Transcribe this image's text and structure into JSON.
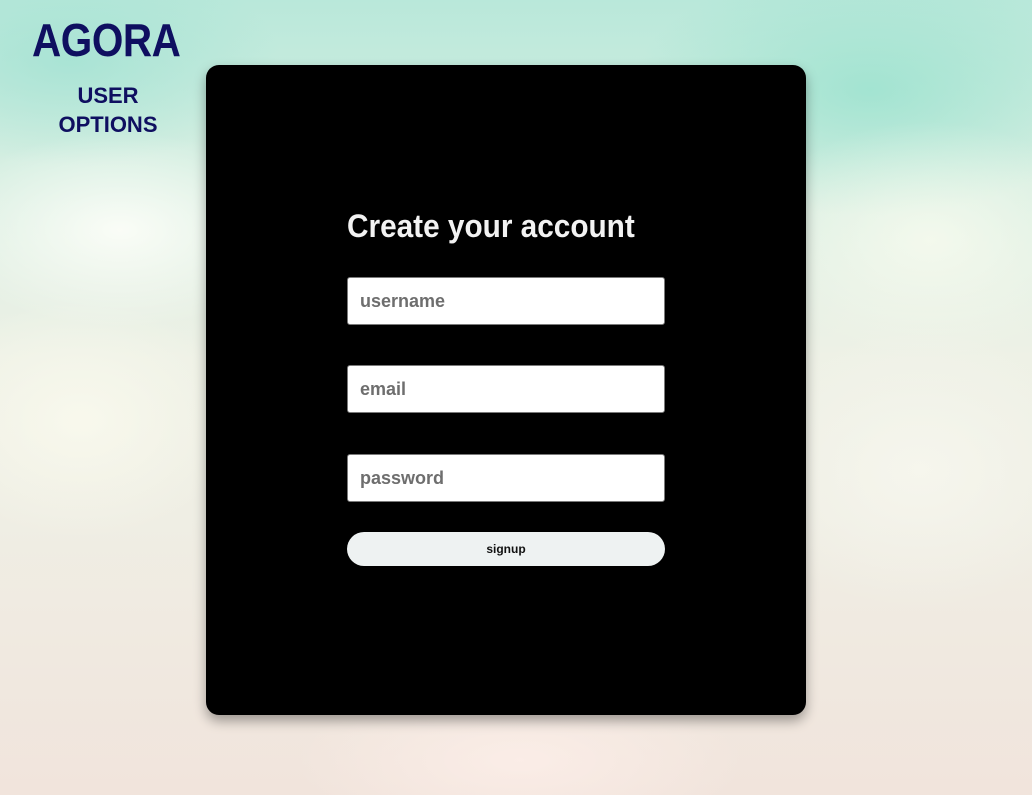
{
  "brand": {
    "title": "AGORA",
    "subtitle": "USER\nOPTIONS",
    "color": "#0f0f60"
  },
  "signup_form": {
    "heading": "Create your account",
    "username": {
      "value": "",
      "placeholder": "username"
    },
    "email": {
      "value": "",
      "placeholder": "email"
    },
    "password": {
      "value": "",
      "placeholder": "password"
    },
    "submit_label": "signup"
  },
  "colors": {
    "card_background": "#000000",
    "heading": "#f2f2f2",
    "button_background": "#eef2f2",
    "sky_top": "#b9e8da",
    "sky_bottom": "#f1e4dc"
  }
}
